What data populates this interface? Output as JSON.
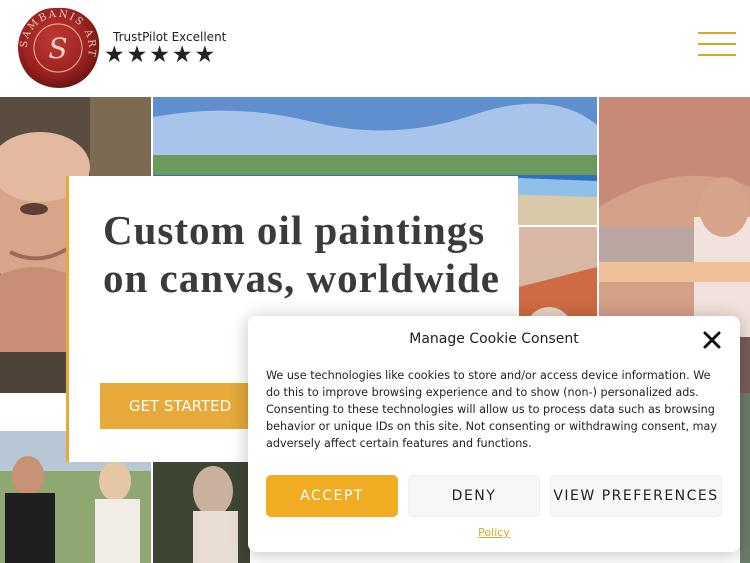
{
  "header": {
    "logo_text": "SAMBANIS ART",
    "logo_initial": "S",
    "trust_label": "TrustPilot Excellent",
    "star_count": 5,
    "star_glyph": "★",
    "menu_icon": "hamburger-icon"
  },
  "hero": {
    "title": "Custom oil paintings on canvas, worldwide",
    "cta_label": "GET STARTED"
  },
  "cookie": {
    "title": "Manage Cookie Consent",
    "close_icon": "close-icon",
    "body": "We use technologies like cookies to store and/or access device information. We do this to improve browsing experience and to show (non-) personalized ads. Consenting to these technologies will allow us to process data such as browsing behavior or unique IDs on this site. Not consenting or withdrawing consent, may adversely affect certain features and functions.",
    "accept_label": "ACCEPT",
    "deny_label": "DENY",
    "preferences_label": "VIEW PREFERENCES",
    "policy_label": "Policy"
  },
  "colors": {
    "accent": "#e6a93a",
    "logo_red": "#9b2220",
    "text": "#222222"
  }
}
